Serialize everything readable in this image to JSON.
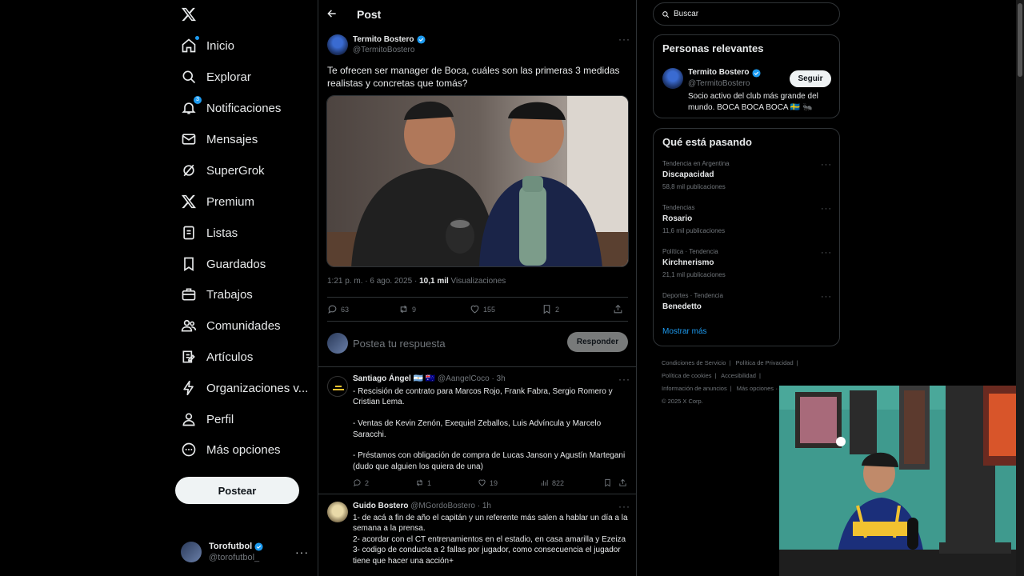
{
  "nav": {
    "items": [
      {
        "label": "Inicio",
        "icon": "home-icon"
      },
      {
        "label": "Explorar",
        "icon": "search-icon"
      },
      {
        "label": "Notificaciones",
        "icon": "bell-icon",
        "badge": "3"
      },
      {
        "label": "Mensajes",
        "icon": "envelope-icon"
      },
      {
        "label": "SuperGrok",
        "icon": "grok-icon"
      },
      {
        "label": "Premium",
        "icon": "x-logo-icon"
      },
      {
        "label": "Listas",
        "icon": "list-icon"
      },
      {
        "label": "Guardados",
        "icon": "bookmark-icon"
      },
      {
        "label": "Trabajos",
        "icon": "briefcase-icon"
      },
      {
        "label": "Comunidades",
        "icon": "people-icon"
      },
      {
        "label": "Artículos",
        "icon": "article-icon"
      },
      {
        "label": "Organizaciones v...",
        "icon": "lightning-icon"
      },
      {
        "label": "Perfil",
        "icon": "person-icon"
      },
      {
        "label": "Más opciones",
        "icon": "more-circle-icon"
      }
    ],
    "post_button": "Postear",
    "account": {
      "name": "Torofutbol",
      "handle": "@torofutbol_",
      "more": "···"
    }
  },
  "header": {
    "title": "Post"
  },
  "tweet": {
    "author": "Termito Bostero",
    "handle": "@TermitoBostero",
    "text": "Te ofrecen ser manager de Boca, cuáles son las primeras 3 medidas realistas y concretas que tomás?",
    "time": "1:21 p. m. · 6 ago. 2025 · ",
    "views": "10,1 mil",
    "views_label": " Visualizaciones",
    "stats": {
      "replies": "63",
      "retweets": "9",
      "likes": "155",
      "bookmarks": "2"
    }
  },
  "reply_box": {
    "placeholder": "Postea tu respuesta",
    "button": "Responder"
  },
  "replies": [
    {
      "name": "Santiago Ángel 🇦🇷 🇦🇺",
      "handle": "@AangelCoco",
      "time": "· 3h",
      "text": "- Rescisión de contrato para Marcos Rojo, Frank Fabra, Sergio Romero y Cristian Lema.\n\n- Ventas de Kevin Zenón, Exequiel Zeballos, Luis Advíncula y Marcelo Saracchi.\n\n- Préstamos con obligación de compra de Lucas Janson y Agustín Martegani (dudo que alguien los quiera de una)",
      "stats": {
        "replies": "2",
        "retweets": "1",
        "likes": "19",
        "views": "822"
      }
    },
    {
      "name": "Guido Bostero",
      "handle": "@MGordoBostero",
      "time": "· 1h",
      "text": "1- de acá a fin de año el capitán y un referente más salen a hablar un día a la semana a la prensa.\n2- acordar con el CT entrenamientos en el estadio, en casa amarilla y Ezeiza\n3- codigo de conducta a 2 fallas por jugador, como consecuencia el jugador tiene que hacer una acción+"
    }
  ],
  "search": {
    "placeholder": "Buscar"
  },
  "relevant": {
    "title": "Personas relevantes",
    "name": "Termito Bostero",
    "handle": "@TermitoBostero",
    "follow": "Seguir",
    "bio": "Socio activo del club más grande del mundo. BOCA BOCA BOCA 🇸🇪 🐜"
  },
  "trends": {
    "title": "Qué está pasando",
    "items": [
      {
        "context": "Tendencia en Argentina",
        "title": "Discapacidad",
        "count": "58,8 mil publicaciones"
      },
      {
        "context": "Tendencias",
        "title": "Rosario",
        "count": "11,6 mil publicaciones"
      },
      {
        "context": "Política · Tendencia",
        "title": "Kirchnerismo",
        "count": "21,1 mil publicaciones"
      },
      {
        "context": "Deportes · Tendencia",
        "title": "Benedetto",
        "count": ""
      }
    ],
    "show_more": "Mostrar más"
  },
  "footer": {
    "links": [
      "Condiciones de Servicio",
      "|",
      "Política de Privacidad",
      "|",
      "Política de cookies",
      "|",
      "Accesibilidad",
      "|",
      "Información de anuncios",
      "|",
      "Más opciones ···"
    ],
    "copyright": "© 2025 X Corp."
  },
  "colors": {
    "accent": "#1d9bf0",
    "background": "#000000",
    "border": "#2f3336",
    "muted": "#71767b",
    "boca_blue": "#1b2f7a",
    "boca_gold": "#f2c230"
  }
}
